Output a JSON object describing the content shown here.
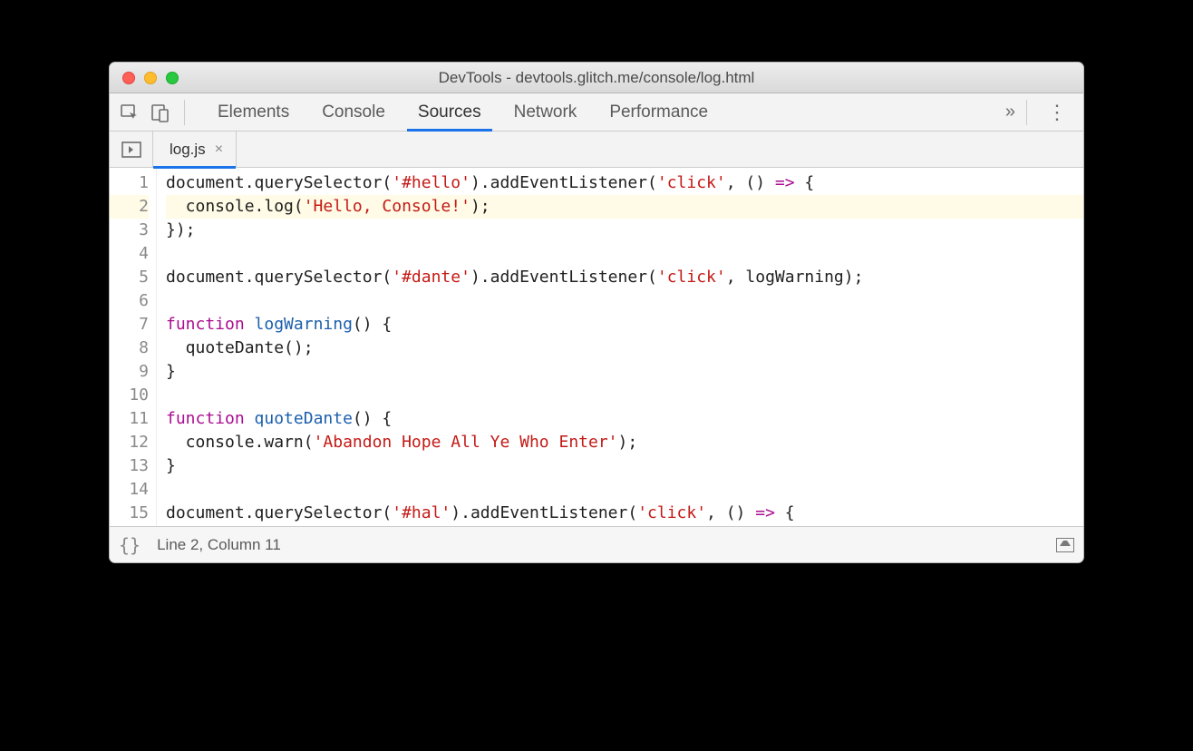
{
  "window": {
    "title": "DevTools - devtools.glitch.me/console/log.html"
  },
  "panels": {
    "items": [
      "Elements",
      "Console",
      "Sources",
      "Network",
      "Performance"
    ],
    "activeIndex": 2,
    "overflow": "»"
  },
  "fileTabs": {
    "items": [
      {
        "name": "log.js",
        "closeGlyph": "×"
      }
    ],
    "activeIndex": 0
  },
  "code": {
    "lines": [
      [
        {
          "t": "document.querySelector(",
          "c": ""
        },
        {
          "t": "'#hello'",
          "c": "s-str"
        },
        {
          "t": ").addEventListener(",
          "c": ""
        },
        {
          "t": "'click'",
          "c": "s-str"
        },
        {
          "t": ", () ",
          "c": ""
        },
        {
          "t": "=>",
          "c": "s-kw"
        },
        {
          "t": " {",
          "c": ""
        }
      ],
      [
        {
          "t": "  console.log(",
          "c": ""
        },
        {
          "t": "'Hello, Console!'",
          "c": "s-str"
        },
        {
          "t": ");",
          "c": ""
        }
      ],
      [
        {
          "t": "});",
          "c": ""
        }
      ],
      [],
      [
        {
          "t": "document.querySelector(",
          "c": ""
        },
        {
          "t": "'#dante'",
          "c": "s-str"
        },
        {
          "t": ").addEventListener(",
          "c": ""
        },
        {
          "t": "'click'",
          "c": "s-str"
        },
        {
          "t": ", logWarning);",
          "c": ""
        }
      ],
      [],
      [
        {
          "t": "function",
          "c": "s-kw"
        },
        {
          "t": " ",
          "c": ""
        },
        {
          "t": "logWarning",
          "c": "s-fn"
        },
        {
          "t": "() {",
          "c": ""
        }
      ],
      [
        {
          "t": "  quoteDante();",
          "c": ""
        }
      ],
      [
        {
          "t": "}",
          "c": ""
        }
      ],
      [],
      [
        {
          "t": "function",
          "c": "s-kw"
        },
        {
          "t": " ",
          "c": ""
        },
        {
          "t": "quoteDante",
          "c": "s-fn"
        },
        {
          "t": "() {",
          "c": ""
        }
      ],
      [
        {
          "t": "  console.warn(",
          "c": ""
        },
        {
          "t": "'Abandon Hope All Ye Who Enter'",
          "c": "s-str"
        },
        {
          "t": ");",
          "c": ""
        }
      ],
      [
        {
          "t": "}",
          "c": ""
        }
      ],
      [],
      [
        {
          "t": "document.querySelector(",
          "c": ""
        },
        {
          "t": "'#hal'",
          "c": "s-str"
        },
        {
          "t": ").addEventListener(",
          "c": ""
        },
        {
          "t": "'click'",
          "c": "s-str"
        },
        {
          "t": ", () ",
          "c": ""
        },
        {
          "t": "=>",
          "c": "s-kw"
        },
        {
          "t": " {",
          "c": ""
        }
      ]
    ],
    "highlightedLines": [
      2
    ]
  },
  "status": {
    "braces": "{}",
    "cursor": "Line 2, Column 11"
  }
}
